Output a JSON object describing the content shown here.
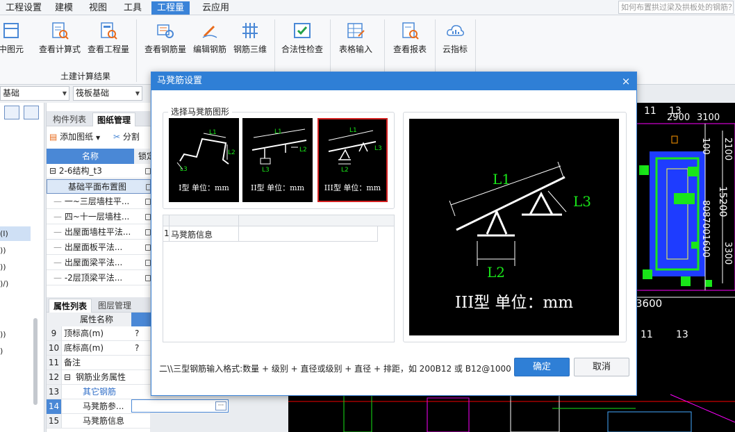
{
  "menu": {
    "items": [
      "工程设置",
      "建模",
      "视图",
      "工具",
      "工程量",
      "云应用"
    ],
    "active": 4,
    "help_placeholder": "如何布置拱过梁及拱板处的钢筋？"
  },
  "ribbon": {
    "buttons": [
      "中图元",
      "查看计算式",
      "查看工程量",
      "查看钢筋量",
      "编辑钢筋",
      "钢筋三维",
      "合法性检查",
      "表格输入",
      "查看报表",
      "云指标"
    ],
    "group_label": "土建计算结果"
  },
  "toolbar": {
    "combo1": "基础",
    "combo2": "筏板基础"
  },
  "left_side": {
    "labels": [
      "(I)",
      "))",
      "))",
      ")/)",
      "))",
      ")"
    ]
  },
  "component_panel": {
    "tabs": [
      "构件列表",
      "图纸管理"
    ],
    "active_tab": 1,
    "toolbar": {
      "add": "添加图纸",
      "split": "分割"
    },
    "columns": [
      "名称",
      "锁定"
    ],
    "rows": [
      "2-6结构_t3",
      "基础平面布置图",
      "一~三层墙柱平...",
      "四~十一层墙柱...",
      "出屋面墙柱平法...",
      "出屋面板平法...",
      "出屋面梁平法...",
      "-2层顶梁平法..."
    ]
  },
  "property_panel": {
    "tabs": [
      "属性列表",
      "图层管理"
    ],
    "active_tab": 0,
    "header": "属性名称",
    "rows": [
      {
        "num": "9",
        "name": "顶标高(m)",
        "value": "?"
      },
      {
        "num": "10",
        "name": "底标高(m)",
        "value": "?"
      },
      {
        "num": "11",
        "name": "备注",
        "value": ""
      },
      {
        "num": "12",
        "name": "钢筋业务属性",
        "value": ""
      },
      {
        "num": "13",
        "name": "其它钢筋",
        "value": ""
      },
      {
        "num": "14",
        "name": "马凳筋参...",
        "value": ""
      },
      {
        "num": "15",
        "name": "马凳筋信息",
        "value": ""
      }
    ]
  },
  "cad": {
    "labels": [
      "11",
      "13",
      "2900",
      "3100",
      "3600",
      "15200",
      "11",
      "13",
      "100",
      "2100",
      "8087001600",
      "3300"
    ]
  },
  "dialog": {
    "title": "马凳筋设置",
    "close": "×",
    "shape_group_label": "选择马凳筋图形",
    "shapes": [
      {
        "caption": "I型 单位：mm",
        "labels": [
          "L1",
          "L2",
          "L3"
        ]
      },
      {
        "caption": "II型 单位：mm",
        "labels": [
          "L1",
          "L2",
          "L3"
        ]
      },
      {
        "caption": "III型 单位：mm",
        "labels": [
          "L1",
          "L2",
          "L3"
        ]
      }
    ],
    "selected_shape": 2,
    "info_rows": [
      {
        "num": "1",
        "name": "马凳筋信息",
        "value": ""
      }
    ],
    "preview": {
      "caption": "III型 单位：mm",
      "labels": [
        "L1",
        "L2",
        "L3"
      ]
    },
    "hint": "二\\\\三型钢筋输入格式:数量 + 级别 + 直径或级别 + 直径 + 排距，如 200B12 或 B12@1000",
    "ok": "确定",
    "cancel": "取消"
  },
  "colors": {
    "accent": "#2f7fd6",
    "selected_border": "#d42020",
    "cad_green": "#19e619"
  }
}
